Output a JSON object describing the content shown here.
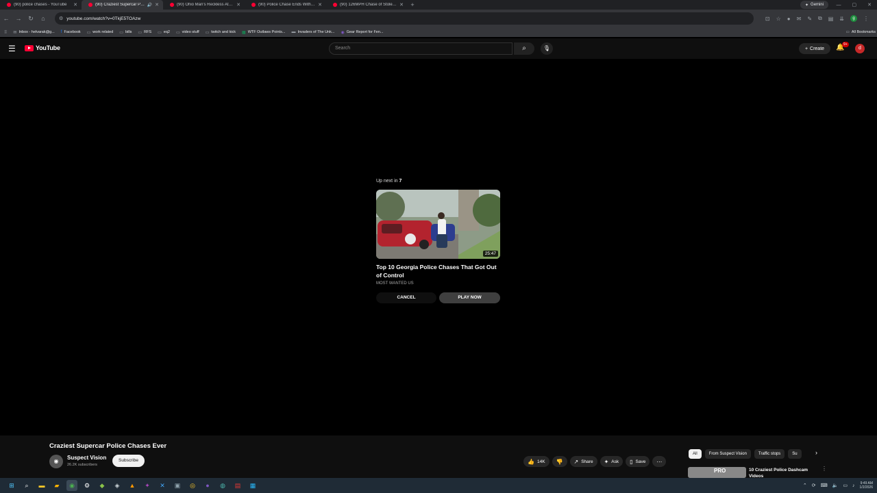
{
  "browser": {
    "tabs": [
      {
        "title": "(90) police chases - YouTube",
        "active": false
      },
      {
        "title": "(90) Craziest Supercar Poli...",
        "active": true,
        "audio": true
      },
      {
        "title": "(90) Ohio Man's Reckless Attem...",
        "active": false
      },
      {
        "title": "(90) Police Chase Ends With SU...",
        "active": false
      },
      {
        "title": "(90) 126MPH Chase of Stolen P...",
        "active": false
      }
    ],
    "gemini_label": "Gemini",
    "url": "youtube.com/watch?v=0TkjE5TOAzw",
    "bookmarks": [
      {
        "label": "Inbox - helvarak@g...",
        "icon": "mail-icon"
      },
      {
        "label": "Facebook",
        "icon": "facebook-icon"
      },
      {
        "label": "work related",
        "icon": "folder-icon"
      },
      {
        "label": "bills",
        "icon": "folder-icon"
      },
      {
        "label": "RFS",
        "icon": "folder-icon"
      },
      {
        "label": "eq2",
        "icon": "folder-icon"
      },
      {
        "label": "video stuff",
        "icon": "folder-icon"
      },
      {
        "label": "twitch and kick",
        "icon": "folder-icon"
      },
      {
        "label": "WTF Outlaws Points...",
        "icon": "sheets-icon"
      },
      {
        "label": "Invaders of The Unk...",
        "icon": "page-icon"
      },
      {
        "label": "Gear Report for Fen...",
        "icon": "site-icon"
      }
    ],
    "all_bookmarks_label": "All Bookmarks",
    "profile_initial": "g"
  },
  "youtube": {
    "logo_text": "YouTube",
    "search_placeholder": "Search",
    "create_label": "Create",
    "notification_count": "9+",
    "avatar_initial": "d"
  },
  "up_next": {
    "prefix": "Up next in ",
    "countdown": "7",
    "duration": "25:47",
    "title": "Top 10 Georgia Police Chases That Got Out of Control",
    "channel": "MOST WANTED US",
    "cancel_label": "CANCEL",
    "play_now_label": "PLAY NOW"
  },
  "video": {
    "title": "Craziest Supercar Police Chases Ever",
    "channel_name": "Suspect Vision",
    "subscribers": "26.2K subscribers",
    "subscribe_label": "Subscribe",
    "likes": "14K",
    "share_label": "Share",
    "ask_label": "Ask",
    "save_label": "Save"
  },
  "recommendations": {
    "chips": [
      "All",
      "From Suspect Vision",
      "Traffic stops",
      "Su"
    ],
    "first_title": "10 Craziest Police Dashcam Videos",
    "first_thumb_text": "PRO"
  },
  "taskbar": {
    "time": "9:49 AM",
    "date": "1/2/2026"
  },
  "colors": {
    "yt_red": "#ff0033",
    "page_bg": "#000000",
    "chrome_dark": "#202124"
  }
}
